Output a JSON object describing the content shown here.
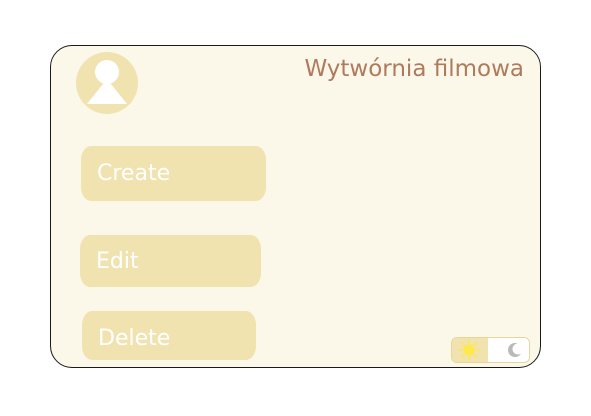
{
  "header": {
    "title": "Wytwórnia filmowa",
    "avatar_icon": "user-avatar-icon"
  },
  "actions": {
    "create_label": "Create",
    "edit_label": "Edit",
    "delete_label": "Delete"
  },
  "theme_toggle": {
    "light_icon": "sun-icon",
    "dark_icon": "moon-icon",
    "selected": "light"
  },
  "colors": {
    "panel_background": "#fbf8ea",
    "button_fill": "#f0e3b0",
    "button_text": "#ffffff",
    "title_text": "#b07a5c",
    "sun": "#ffe84a"
  }
}
